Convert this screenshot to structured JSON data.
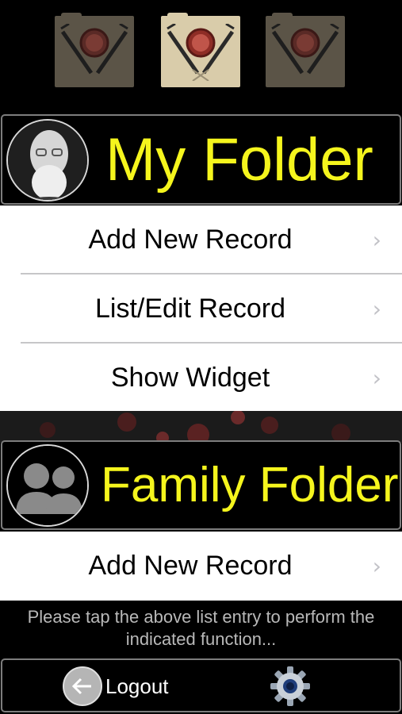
{
  "folder_tabs": [
    {
      "name": "folder-tab-1",
      "state": "inactive"
    },
    {
      "name": "folder-tab-2",
      "state": "active"
    },
    {
      "name": "folder-tab-3",
      "state": "inactive"
    }
  ],
  "my_folder": {
    "title": "My Folder",
    "avatar_icon": "user-photo-avatar",
    "items": [
      {
        "label": "Add New Record",
        "chevron": "›"
      },
      {
        "label": "List/Edit Record",
        "chevron": "›"
      },
      {
        "label": "Show Widget",
        "chevron": "›"
      }
    ]
  },
  "family_folder": {
    "title": "Family Folder",
    "avatar_icon": "family-group-icon",
    "items": [
      {
        "label": "Add New Record",
        "chevron": "›"
      }
    ]
  },
  "hint": {
    "line1": "Please tap the above list entry to perform the",
    "line2": "indicated function..."
  },
  "bottom_bar": {
    "logout_label": "Logout",
    "logout_icon": "arrow-left-icon",
    "settings_icon": "gear-icon"
  },
  "colors": {
    "accent_yellow": "#f5f51d",
    "folder_active": "#d9ccaa",
    "folder_inactive": "#5b5447",
    "border_gray": "#7d7d7d"
  }
}
